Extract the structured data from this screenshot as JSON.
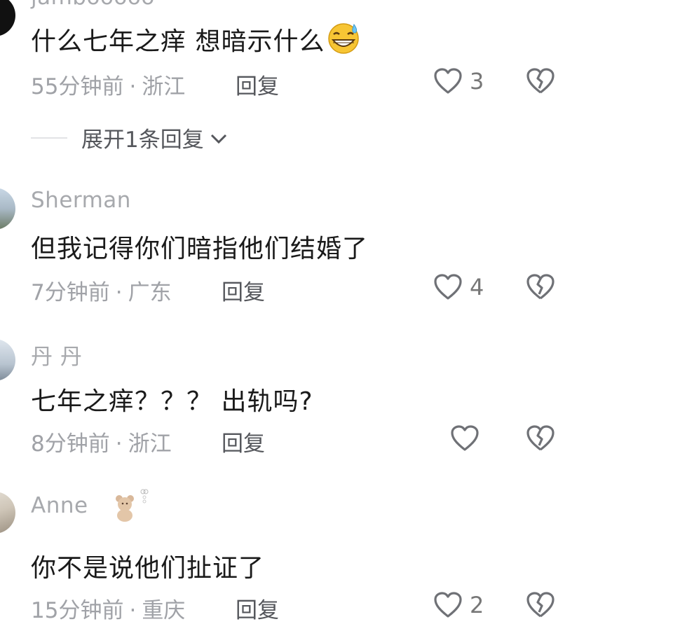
{
  "comments": [
    {
      "username": "jambooooo",
      "text": "什么七年之痒 想暗示什么",
      "emoji": "grinning-sweat-emoji",
      "time": "55分钟前",
      "sep": "·",
      "location": "浙江",
      "reply_label": "回复",
      "likes": "3"
    },
    {
      "username": "Sherman",
      "text": "但我记得你们暗指他们结婚了",
      "time": "7分钟前",
      "sep": "·",
      "location": "广东",
      "reply_label": "回复",
      "likes": "4"
    },
    {
      "username": "丹 丹",
      "text": "七年之痒？？？ 出轨吗?",
      "time": "8分钟前",
      "sep": "·",
      "location": "浙江",
      "reply_label": "回复",
      "likes": ""
    },
    {
      "username": "Anne",
      "badge": "teddy-bear-badge",
      "text": "你不是说他们扯证了",
      "time": "15分钟前",
      "sep": "·",
      "location": "重庆",
      "reply_label": "回复",
      "likes": "2"
    }
  ],
  "expand_replies_label": "展开1条回复",
  "colors": {
    "username": "#a7a9ad",
    "meta": "#a0a2a7",
    "text": "#1a1a1a"
  }
}
